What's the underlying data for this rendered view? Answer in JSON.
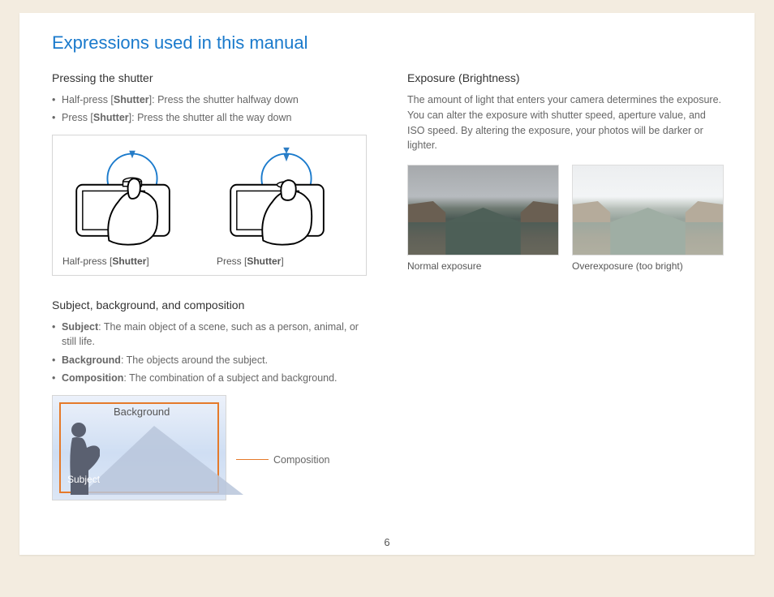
{
  "title": "Expressions used in this manual",
  "page_number": "6",
  "left": {
    "section1": {
      "heading": "Pressing the shutter",
      "bullets": [
        {
          "prefix": "Half-press [",
          "bold": "Shutter",
          "suffix": "]: Press the shutter halfway down"
        },
        {
          "prefix": "Press [",
          "bold": "Shutter",
          "suffix": "]: Press the shutter all the way down"
        }
      ],
      "captions": {
        "half": {
          "prefix": "Half-press [",
          "bold": "Shutter",
          "suffix": "]"
        },
        "full": {
          "prefix": "Press [",
          "bold": "Shutter",
          "suffix": "]"
        }
      }
    },
    "section2": {
      "heading": "Subject, background, and composition",
      "bullets": [
        {
          "bold": "Subject",
          "text": ": The main object of a scene, such as a person, animal, or still life."
        },
        {
          "bold": "Background",
          "text": ": The objects around the subject."
        },
        {
          "bold": "Composition",
          "text": ": The combination of a subject and background."
        }
      ],
      "labels": {
        "background": "Background",
        "subject": "Subject",
        "composition": "Composition"
      }
    }
  },
  "right": {
    "heading": "Exposure (Brightness)",
    "paragraph": "The amount of light that enters your camera determines the exposure. You can alter the exposure with shutter speed, aperture value, and ISO speed. By altering the exposure, your photos will be darker or lighter.",
    "captions": {
      "normal": "Normal exposure",
      "over": "Overexposure (too bright)"
    }
  }
}
